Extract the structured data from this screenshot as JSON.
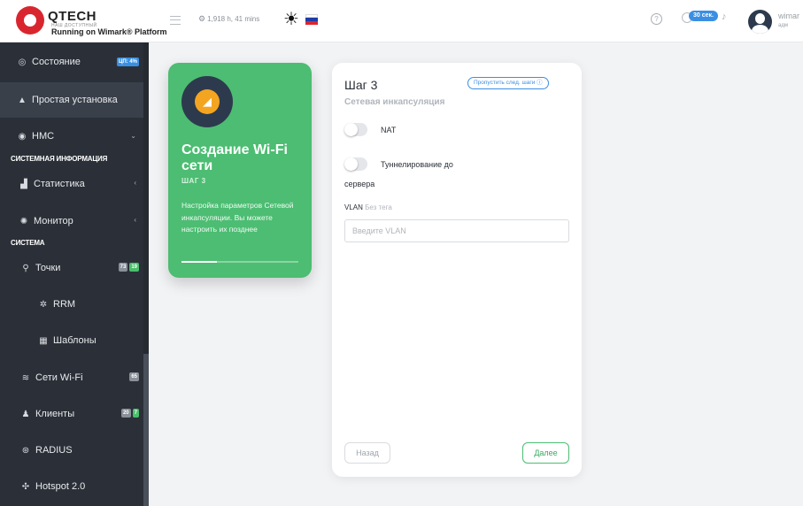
{
  "header": {
    "logo_text": "QTECH",
    "logo_tagline": "НАШ ДОСТУПНЫЙ",
    "platform": "Running on Wimark® Platform",
    "uptime": "1,918 h, 41 mins",
    "timer_badge": "30 сек.",
    "user_name": "wimar",
    "user_role": "адм"
  },
  "sidebar": {
    "state": {
      "label": "Состояние",
      "badge": "ЦП: 4%"
    },
    "quick_setup": "Простая установка",
    "hmc": "НМС",
    "section_sysinfo": "СИСТЕМНАЯ ИНФОРМАЦИЯ",
    "stats": "Статистика",
    "monitor": "Монитор",
    "section_system": "СИСТЕМА",
    "points": {
      "label": "Точки",
      "badge1": "73",
      "badge2": "19"
    },
    "rrm": "RRM",
    "templates": "Шаблоны",
    "wifi": {
      "label": "Сети Wi-Fi",
      "badge": "65"
    },
    "clients": {
      "label": "Клиенты",
      "badge1": "20",
      "badge2": "7"
    },
    "radius": "RADIUS",
    "hotspot": "Hotspot 2.0"
  },
  "wizard": {
    "title": "Создание Wi-Fi сети",
    "step": "ШАГ 3",
    "description": "Настройка параметров Сетевой инкапсуляции. Вы можете настроить их позднее",
    "progress": 0.3
  },
  "form": {
    "title": "Шаг 3",
    "subtitle": "Сетевая инкапсуляция",
    "skip_label": "Пропустить след. шаги ⓘ",
    "nat_label": "NAT",
    "tunnel_label_line1": "Туннелирование до",
    "tunnel_label_line2": "сервера",
    "vlan_label": "VLAN",
    "vlan_hint": "Без тега",
    "vlan_placeholder": "Введите VLAN",
    "vlan_value": "",
    "back_label": "Назад",
    "next_label": "Далее"
  },
  "colors": {
    "accent_green": "#4cbd72",
    "accent_blue": "#3b8fe3",
    "sidebar_bg": "#2b3038",
    "brand_red": "#d9262e"
  }
}
